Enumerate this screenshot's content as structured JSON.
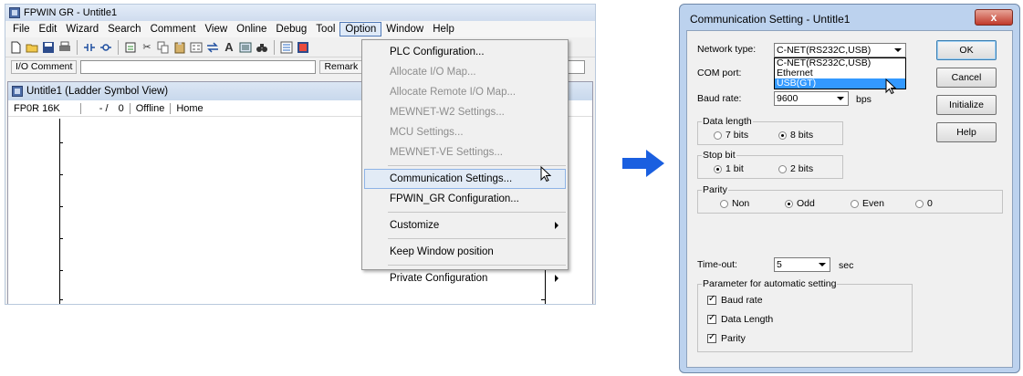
{
  "app": {
    "title": "FPWIN GR - Untitle1",
    "menus": [
      "File",
      "Edit",
      "Wizard",
      "Search",
      "Comment",
      "View",
      "Online",
      "Debug",
      "Tool",
      "Option",
      "Window",
      "Help"
    ],
    "active_menu": "Option",
    "comment_bar": {
      "io_comment_label": "I/O Comment",
      "remark_label": "Remark"
    },
    "child_window": {
      "title": "Untitle1 (Ladder Symbol View)",
      "status": {
        "plc": "FP0R 16K",
        "pos": "- /",
        "steps": "0",
        "mode": "Offline",
        "home": "Home"
      }
    }
  },
  "option_menu": {
    "items": [
      {
        "label": "PLC Configuration...",
        "enabled": true
      },
      {
        "label": "Allocate I/O Map...",
        "enabled": false
      },
      {
        "label": "Allocate Remote I/O Map...",
        "enabled": false
      },
      {
        "label": "MEWNET-W2 Settings...",
        "enabled": false
      },
      {
        "label": "MCU Settings...",
        "enabled": false
      },
      {
        "label": "MEWNET-VE Settings...",
        "enabled": false
      },
      {
        "label": "Communication Settings...",
        "enabled": true,
        "highlighted": true
      },
      {
        "label": "FPWIN_GR Configuration...",
        "enabled": true
      },
      {
        "label": "Customize",
        "enabled": true,
        "submenu": true
      },
      {
        "label": "Keep Window position",
        "enabled": true
      },
      {
        "label": "Private Configuration",
        "enabled": true,
        "submenu": true
      }
    ]
  },
  "arrow_color": "#1a5fe0",
  "dialog": {
    "title": "Communication Setting - Untitle1",
    "close": "x",
    "network_type": {
      "label": "Network type:",
      "value": "C-NET(RS232C,USB)",
      "options": [
        "C-NET(RS232C,USB)",
        "Ethernet",
        "USB(GT)"
      ],
      "selected_option": "USB(GT)"
    },
    "com_port": {
      "label": "COM port:"
    },
    "baud_rate": {
      "label": "Baud rate:",
      "value": "9600",
      "unit": "bps"
    },
    "data_length": {
      "label": "Data length",
      "options": [
        "7 bits",
        "8 bits"
      ],
      "selected": "8 bits"
    },
    "stop_bit": {
      "label": "Stop bit",
      "options": [
        "1 bit",
        "2 bits"
      ],
      "selected": "1 bit"
    },
    "parity": {
      "label": "Parity",
      "options": [
        "Non",
        "Odd",
        "Even",
        "0"
      ],
      "selected": "Odd"
    },
    "timeout": {
      "label": "Time-out:",
      "value": "5",
      "unit": "sec"
    },
    "auto_params": {
      "label": "Parameter for automatic setting",
      "items": [
        {
          "label": "Baud rate",
          "checked": true
        },
        {
          "label": "Data Length",
          "checked": true
        },
        {
          "label": "Parity",
          "checked": true
        }
      ]
    },
    "buttons": {
      "ok": "OK",
      "cancel": "Cancel",
      "initialize": "Initialize",
      "help": "Help"
    }
  }
}
